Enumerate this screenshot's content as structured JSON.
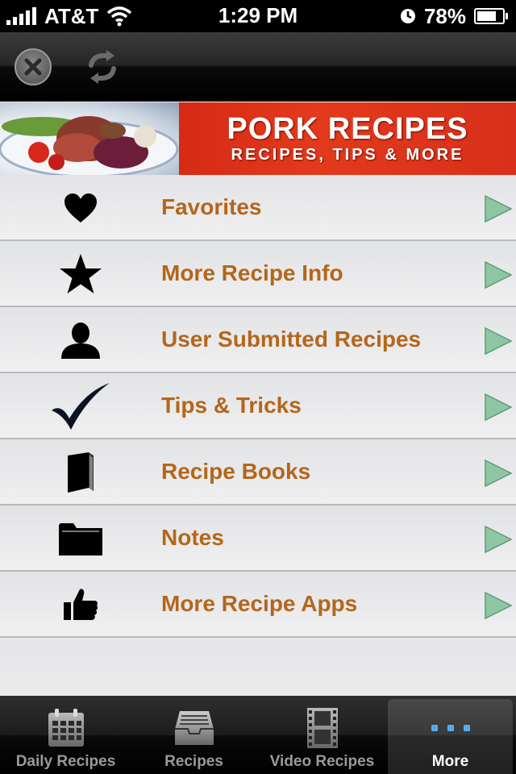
{
  "status_bar": {
    "carrier": "AT&T",
    "time": "1:29 PM",
    "battery_percent": "78%",
    "battery_level": 0.78
  },
  "toolbar": {
    "close_icon": "close-icon",
    "refresh_icon": "refresh-icon"
  },
  "banner": {
    "title": "PORK RECIPES",
    "subtitle": "RECIPES, TIPS & MORE"
  },
  "menu": {
    "items": [
      {
        "label": "Favorites",
        "icon": "heart-icon"
      },
      {
        "label": "More Recipe Info",
        "icon": "star-icon"
      },
      {
        "label": "User Submitted Recipes",
        "icon": "user-icon"
      },
      {
        "label": "Tips & Tricks",
        "icon": "checkmark-icon"
      },
      {
        "label": "Recipe Books",
        "icon": "book-icon"
      },
      {
        "label": "Notes",
        "icon": "folder-icon"
      },
      {
        "label": "More Recipe Apps",
        "icon": "thumbs-up-icon"
      }
    ],
    "arrow_color": "#8fc7a4"
  },
  "tabs": [
    {
      "label": "Daily Recipes",
      "icon": "calendar-icon",
      "active": false
    },
    {
      "label": "Recipes",
      "icon": "inbox-tray-icon",
      "active": false
    },
    {
      "label": "Video Recipes",
      "icon": "film-icon",
      "active": false
    },
    {
      "label": "More",
      "icon": "more-dots-icon",
      "active": true
    }
  ],
  "colors": {
    "label": "#b4661a",
    "banner_red": "#d52a14",
    "active_dots": "#5aa8e8"
  }
}
